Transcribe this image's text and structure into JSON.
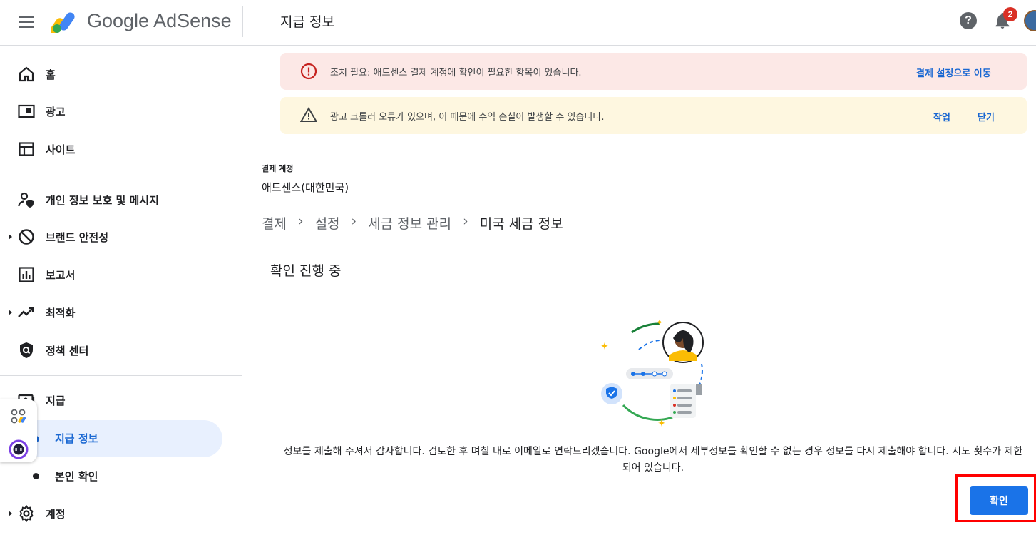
{
  "header": {
    "brand": "Google AdSense",
    "page_title": "지급 정보",
    "help_icon": "?",
    "notification_count": "2"
  },
  "sidebar": {
    "items": [
      {
        "label": "홈",
        "icon": "home-icon"
      },
      {
        "label": "광고",
        "icon": "ads-icon"
      },
      {
        "label": "사이트",
        "icon": "sites-icon"
      },
      {
        "label": "개인 정보 보호 및 메시지",
        "icon": "privacy-icon"
      },
      {
        "label": "브랜드 안전성",
        "icon": "block-icon"
      },
      {
        "label": "보고서",
        "icon": "reports-icon"
      },
      {
        "label": "최적화",
        "icon": "trending-icon"
      },
      {
        "label": "정책 센터",
        "icon": "policy-icon"
      },
      {
        "label": "지급",
        "icon": "payments-icon"
      },
      {
        "label": "계정",
        "icon": "gear-icon"
      }
    ],
    "sub_items": [
      {
        "label": "지급 정보",
        "active": true
      },
      {
        "label": "본인 확인",
        "active": false
      }
    ]
  },
  "alerts": [
    {
      "type": "error",
      "text": "조치 필요: 애드센스 결제 계정에 확인이 필요한 항목이 있습니다.",
      "actions": [
        "결제 설정으로 이동"
      ]
    },
    {
      "type": "warning",
      "text": "광고 크롤러 오류가 있으며, 이 때문에 수익 손실이 발생할 수 있습니다.",
      "actions": [
        "작업",
        "닫기"
      ]
    }
  ],
  "account": {
    "label": "결제 계정",
    "name": "애드센스(대한민국)"
  },
  "breadcrumb": [
    "결제",
    "설정",
    "세금 정보 관리",
    "미국 세금 정보"
  ],
  "section_title": "확인 진행 중",
  "message": "정보를 제출해 주셔서 감사합니다. 검토한 후 며칠 내로 이메일로 연락드리겠습니다. Google에서 세부정보를 확인할 수 없는 경우 정보를 다시 제출해야 합니다. 시도 횟수가 제한되어 있습니다.",
  "confirm_button": "확인",
  "colors": {
    "accent": "#1a73e8",
    "error": "#d93025",
    "warning_bg": "#fef7e0",
    "error_bg": "#fce8e6",
    "highlight": "#ff0000"
  }
}
